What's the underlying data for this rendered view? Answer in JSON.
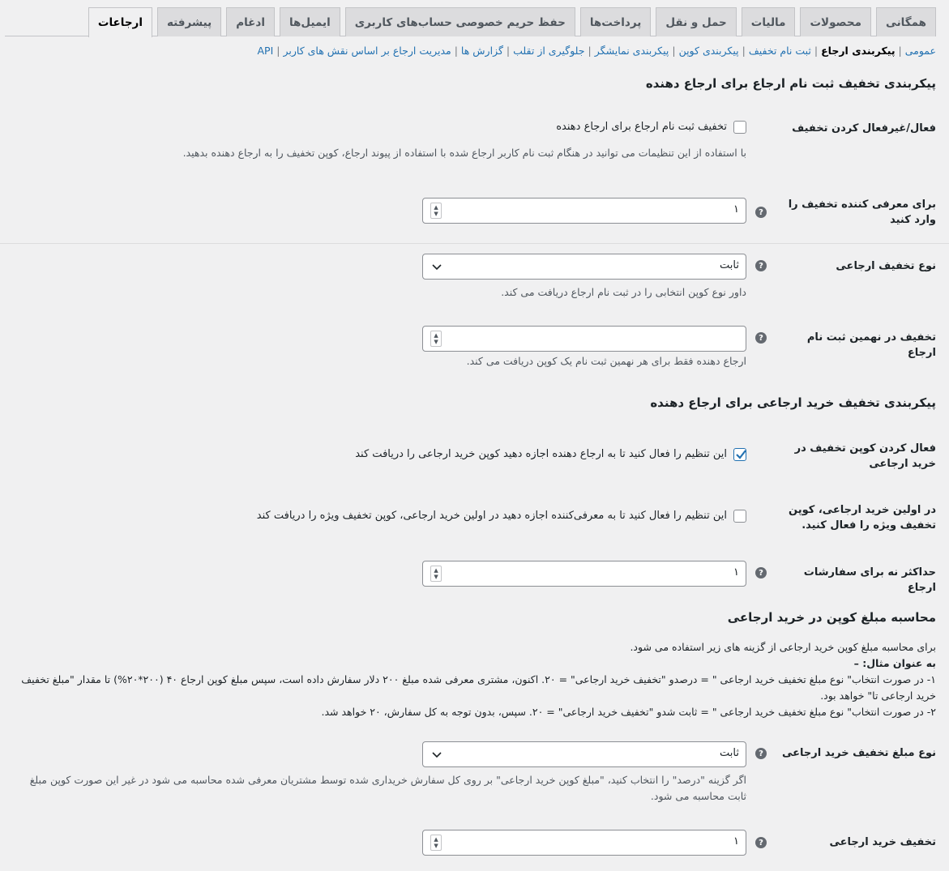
{
  "tabs": [
    {
      "label": "همگانی",
      "active": false
    },
    {
      "label": "محصولات",
      "active": false
    },
    {
      "label": "مالیات",
      "active": false
    },
    {
      "label": "حمل و نقل",
      "active": false
    },
    {
      "label": "پرداخت‌ها",
      "active": false
    },
    {
      "label": "حفظ حریم خصوصی حساب‌های کاربری",
      "active": false
    },
    {
      "label": "ایمیل‌ها",
      "active": false
    },
    {
      "label": "ادغام",
      "active": false
    },
    {
      "label": "پیشرفته",
      "active": false
    },
    {
      "label": "ارجاعات",
      "active": true
    }
  ],
  "subnav": [
    {
      "label": "عمومی",
      "current": false
    },
    {
      "label": "پیکربندی ارجاع",
      "current": true
    },
    {
      "label": "ثبت نام تخفیف",
      "current": false
    },
    {
      "label": "پیکربندی کوپن",
      "current": false
    },
    {
      "label": "پیکربندی نمایشگر",
      "current": false
    },
    {
      "label": "جلوگیری از تقلب",
      "current": false
    },
    {
      "label": "گزارش ها",
      "current": false
    },
    {
      "label": "مدیریت ارجاع بر اساس نقش های کاربر",
      "current": false
    },
    {
      "label": "API",
      "current": false
    }
  ],
  "section1": {
    "title": "پیکربندی تخفیف ثبت نام ارجاع برای ارجاع دهنده",
    "enable_label": "فعال/غیرفعال کردن تخفیف",
    "enable_checkbox_label": "تخفیف ثبت نام ارجاع برای ارجاع دهنده",
    "enable_checked": false,
    "enable_desc": "با استفاده از این تنظیمات می توانید در هنگام ثبت نام کاربر ارجاع شده با استفاده از پیوند ارجاع، کوپن تخفیف را به ارجاع دهنده بدهید.",
    "amount_label": "برای معرفی کننده تخفیف را وارد کنید",
    "amount_value": "۱",
    "type_label": "نوع تخفیف ارجاعی",
    "type_value": "ثابت",
    "type_desc": "داور نوع کوپن انتخابی را در ثبت نام ارجاع دریافت می کند.",
    "nth_label": "تخفیف در نهمین ثبت نام ارجاع",
    "nth_value": "",
    "nth_desc": "ارجاع دهنده فقط برای هر نهمین ثبت نام یک کوپن دریافت می کند."
  },
  "section2": {
    "title": "پیکربندی تخفیف خرید ارجاعی برای ارجاع دهنده",
    "enable_label": "فعال کردن کوپن تخفیف در خرید ارجاعی",
    "enable_checkbox_label": "این تنظیم را فعال کنید تا به ارجاع دهنده اجازه دهید کوپن خرید ارجاعی را دریافت کند",
    "enable_checked": true,
    "first_label": "در اولین خرید ارجاعی، کوپن تخفیف ویژه را فعال کنید.",
    "first_checkbox_label": "این تنظیم را فعال کنید تا به معرفی‌کننده اجازه دهید در اولین خرید ارجاعی، کوپن تخفیف ویژه را دریافت کند",
    "first_checked": false,
    "max_label": "حداکثر نه برای سفارشات ارجاع",
    "max_value": "۱"
  },
  "section3": {
    "title": "محاسبه مبلغ کوپن در خرید ارجاعی",
    "info_line1": "برای محاسبه مبلغ کوپن خرید ارجاعی از گزینه های زیر استفاده می شود.",
    "info_line2": "به عنوان مثال: –",
    "info_line3": "۱- در صورت انتخاب\" نوع مبلغ تخفیف خرید ارجاعی \" = درصدو \"تخفیف خرید ارجاعی\" = ۲۰. اکنون، مشتری معرفی شده مبلغ ۲۰۰ دلار سفارش داده است، سپس مبلغ کوپن ارجاع ۴۰ (۲۰۰*۲۰%) تا مقدار \"مبلغ تخفیف خرید ارجاعی تا\" خواهد بود.",
    "info_line4": "۲- در صورت انتخاب\" نوع مبلغ تخفیف خرید ارجاعی \" = ثابت شدو \"تخفیف خرید ارجاعی\" = ۲۰. سپس، بدون توجه به کل سفارش، ۲۰ خواهد شد.",
    "amount_type_label": "نوع مبلغ تخفیف خرید ارجاعی",
    "amount_type_value": "ثابت",
    "amount_type_desc": "اگر گزینه \"درصد\" را انتخاب کنید، \"مبلغ کوپن خرید ارجاعی\" بر روی کل سفارش خریداری شده توسط مشتریان معرفی شده محاسبه می شود در غیر این صورت کوپن مبلغ ثابت محاسبه می شود.",
    "purchase_label": "تخفیف خرید ارجاعی",
    "purchase_value": "۱"
  },
  "icons": {
    "help": "question-circle-icon",
    "spinner": "number-spinner-icon",
    "dropdown": "chevron-down-icon",
    "check": "checkmark-icon"
  },
  "colors": {
    "link": "#2271b1",
    "background": "#f0f0f1",
    "checkbox_check": "#2271b1"
  }
}
